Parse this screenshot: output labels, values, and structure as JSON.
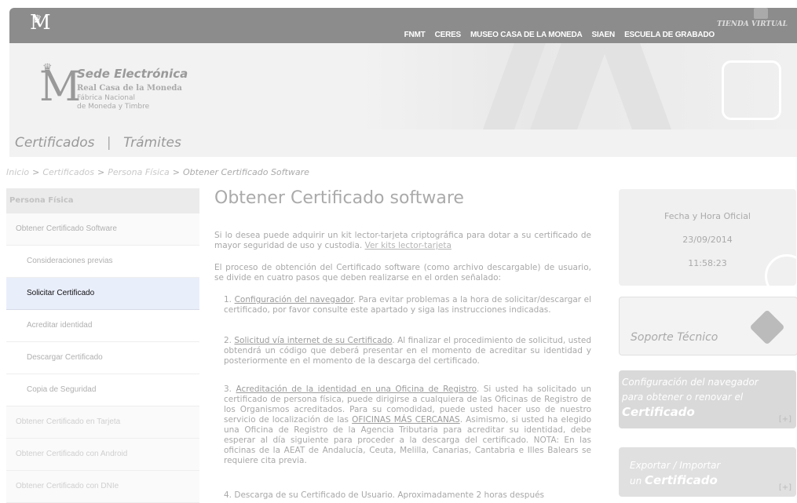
{
  "topbar": {
    "logo_letter": "M",
    "nav": [
      "FNMT",
      "CERES",
      "MUSEO CASA DE LA MONEDA",
      "SIAEN",
      "ESCUELA DE GRABADO"
    ],
    "tienda": "TIENDA VIRTUAL"
  },
  "header": {
    "logo_letter": "M",
    "sede": "Sede Electrónica",
    "rcm": "Real Casa de la Moneda",
    "fabrica_1": "Fábrica Nacional",
    "fabrica_2": "de Moneda y Timbre",
    "tab_certificados": "Certificados",
    "tab_sep": "|",
    "tab_tramites": "Trámites"
  },
  "breadcrumb": {
    "inicio": "Inicio",
    "certificados": "Certificados",
    "persona_fisica": "Persona Física",
    "current": "Obtener Certificado Software",
    "sep": ">"
  },
  "sidebar": {
    "heading": "Persona Física",
    "items": [
      "Obtener Certificado Software",
      "Consideraciones previas",
      "Solicitar Certificado",
      "Acreditar identidad",
      "Descargar Certificado",
      "Copia de Seguridad",
      "Obtener Certificado en Tarjeta",
      "Obtener Certificado con Android",
      "Obtener Certificado con DNIe"
    ]
  },
  "main": {
    "title": "Obtener Certificado software",
    "intro_text": "Si lo desea puede adquirir un kit lector-tarjeta criptográfica para dotar a su certificado de mayor seguridad de uso y custodia.",
    "intro_link": "Ver kits lector-tarjeta",
    "process_text": "El proceso de obtención del Certificado software (como archivo descargable) de usuario, se divide en cuatro pasos que deben realizarse en el orden señalado:",
    "step1_num": "1.",
    "step1_link": "Configuración del navegador",
    "step1_text": ". Para evitar problemas a la hora de solicitar/descargar el certificado, por favor consulte este apartado y siga las instrucciones indicadas.",
    "step2_num": "2.",
    "step2_link": "Solicitud vía internet de su Certificado",
    "step2_text": ". Al finalizar el procedimiento de solicitud, usted obtendrá un código que deberá presentar en el momento de acreditar su identidad y posteriormente en el momento de la descarga del certificado.",
    "step3_num": "3.",
    "step3_link": "Acreditación de la identidad en una Oficina de Registro",
    "step3_text_a": ". Si usted ha solicitado un certificado de persona física, puede dirigirse a cualquiera de las Oficinas de Registro de los Organismos acreditados. Para su comodidad, puede usted hacer uso de nuestro servicio de localización de las ",
    "step3_link2": "OFICINAS MÁS CERCANAS",
    "step3_text_b": ". Asimismo, si usted ha elegido una Oficina de Registro de la Agencia Tributaria para acreditar su identidad, debe esperar al día siguiente para proceder a la descarga del certificado. NOTA: En las oficinas de la AEAT de Andalucía, Ceuta, Melilla, Canarias, Cantabria e Illes Balears se requiere cita previa.",
    "step4_num": "4.",
    "step4_text": "Descarga de su Certificado de Usuario. Aproximadamente 2 horas después"
  },
  "right": {
    "fecha_label": "Fecha y Hora Oficial",
    "fecha": "23/09/2014",
    "hora": "11:58:23",
    "soporte": "Soporte Técnico",
    "conf_line1": "Configuración del navegador",
    "conf_line2": "para obtener o renovar el",
    "conf_big": "Certificado",
    "plus": "[+]",
    "exp_line1": "Exportar / Importar",
    "exp_pre": "un",
    "exp_big": "Certificado"
  }
}
